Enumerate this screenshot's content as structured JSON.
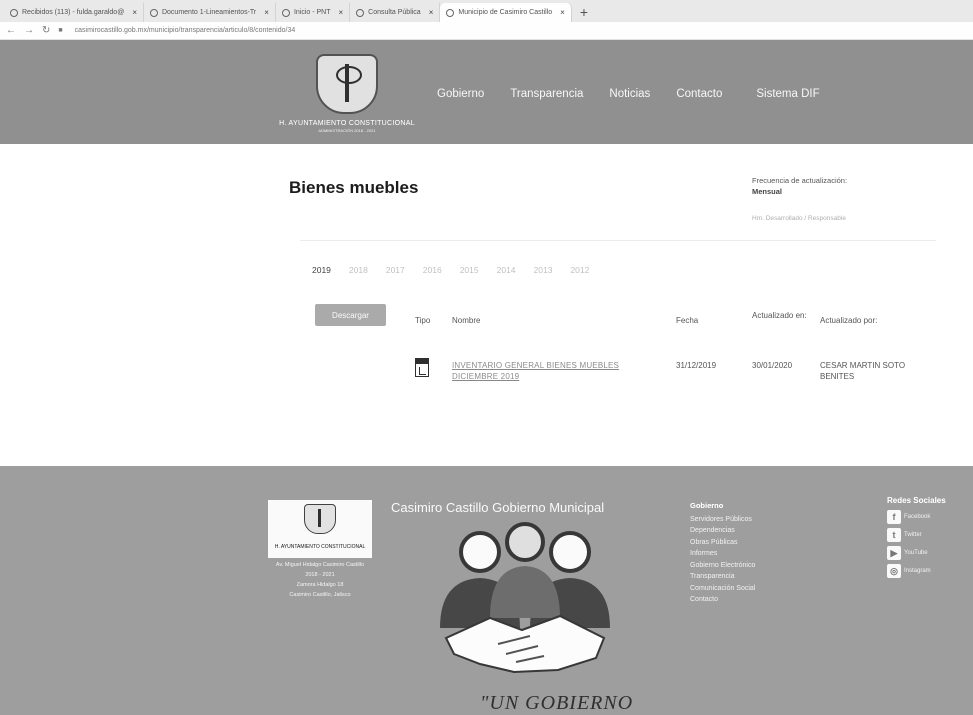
{
  "browser": {
    "tabs": [
      {
        "label": "Recibidos (113) - fulda.garaldo@",
        "icon": "gmail-icon"
      },
      {
        "label": "Documento 1-Lineamientos-Tr",
        "icon": "globe-icon"
      },
      {
        "label": "Inicio - PNT",
        "icon": "pnt-icon"
      },
      {
        "label": "Consulta Pública",
        "icon": "globe-icon"
      },
      {
        "label": "Municipio de Casimiro Castillo",
        "icon": "globe-icon"
      }
    ],
    "new_tab": "+",
    "url": "casimirocastillo.gob.mx/municipio/transparencia/articulo/8/contenido/34"
  },
  "header": {
    "logo_title": "H. AYUNTAMIENTO CONSTITUCIONAL",
    "logo_sub": "ADMINISTRACIÓN 2018 - 2021",
    "nav": [
      "Gobierno",
      "Transparencia",
      "Noticias",
      "Contacto",
      "Sistema DIF"
    ]
  },
  "content": {
    "title": "Bienes muebles",
    "freq_label": "Frecuencia de actualización:",
    "freq_value": "Mensual",
    "responsible": "Hm. Desarrollado / Responsable",
    "years": [
      "2019",
      "2018",
      "2017",
      "2016",
      "2015",
      "2014",
      "2013",
      "2012"
    ],
    "download_button": "Descargar",
    "table": {
      "headers": {
        "tipo": "Tipo",
        "nombre": "Nombre",
        "fecha": "Fecha",
        "actualizado_en": "Actualizado en:",
        "actualizado_por": "Actualizado por:"
      },
      "rows": [
        {
          "nombre": "INVENTARIO GENERAL BIENES MUEBLES DICIEMBRE 2019",
          "fecha": "31/12/2019",
          "actualizado_en": "30/01/2020",
          "actualizado_por": "CESAR MARTIN SOTO BENITES"
        }
      ]
    }
  },
  "footer": {
    "logo_title": "H. AYUNTAMIENTO CONSTITUCIONAL",
    "address": [
      "Av. Miguel Hidalgo Casimiro Castillo",
      "2018 - 2021",
      "Zamora Hidalgo 18",
      "Casimiro Castillo, Jalisco"
    ],
    "title": "Casimiro Castillo Gobierno Municipal",
    "slogan": "\"UN GOBIERNO",
    "gobierno_heading": "Gobierno",
    "gobierno_links": [
      "Servidores Públicos",
      "Dependencias",
      "Obras Públicas",
      "Informes",
      "Gobierno Electrónico",
      "Transparencia",
      "Comunicación Social",
      "Contacto"
    ],
    "social_heading": "Redes Sociales",
    "social": [
      {
        "label": "Facebook",
        "glyph": "f"
      },
      {
        "label": "Twitter",
        "glyph": "t"
      },
      {
        "label": "YouTube",
        "glyph": "▶"
      },
      {
        "label": "Instagram",
        "glyph": "◎"
      }
    ]
  }
}
